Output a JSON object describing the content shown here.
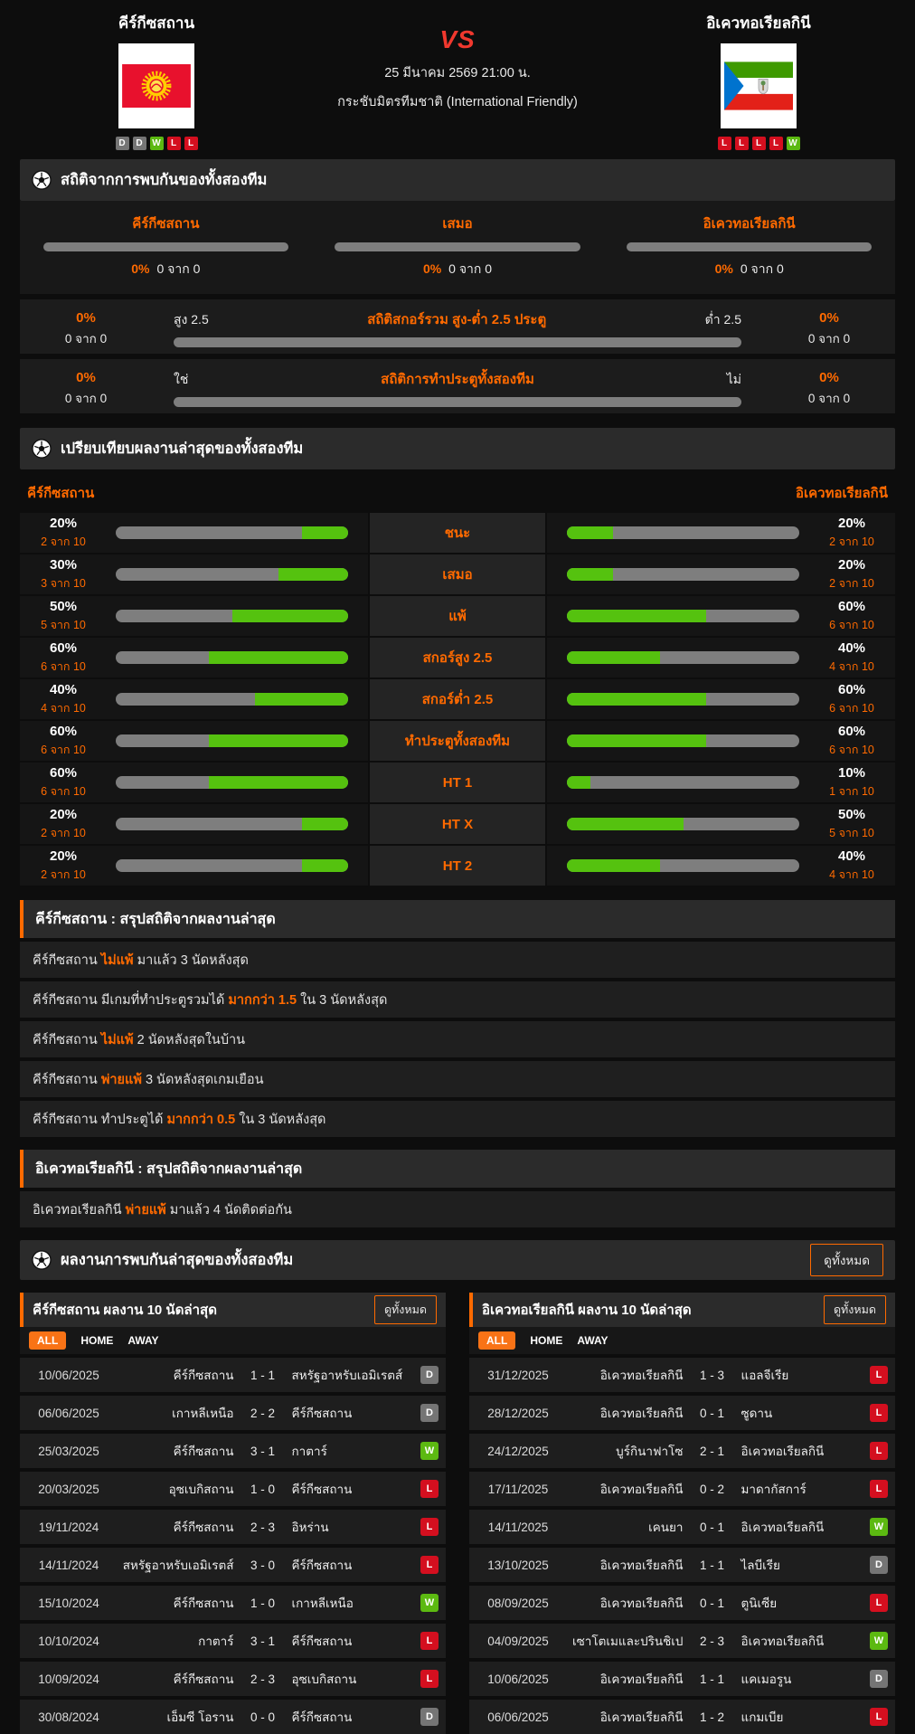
{
  "colors": {
    "accent_orange": "#ff6a00",
    "bar_green": "#55c20f",
    "bar_gray": "#7e7e7e",
    "badge_win": "#5cb911",
    "badge_draw": "#757575",
    "badge_loss": "#d40f1f",
    "vs_red": "#f0382e"
  },
  "header": {
    "home": {
      "name": "คีร์กีซสถาน",
      "form": [
        "D",
        "D",
        "W",
        "L",
        "L"
      ]
    },
    "away": {
      "name": "อิเควทอเรียลกินี",
      "form": [
        "L",
        "L",
        "L",
        "L",
        "W"
      ]
    },
    "vs": "VS",
    "datetime": "25 มีนาคม 2569 21:00 น.",
    "competition": "กระชับมิตรทีมชาติ (International Friendly)"
  },
  "h2h_stats": {
    "title": "สถิติจากการพบกันของทั้งสองทีม",
    "columns": [
      {
        "label": "คีร์กีซสถาน",
        "pct": "0%",
        "count": "0 จาก 0"
      },
      {
        "label": "เสมอ",
        "pct": "0%",
        "count": "0 จาก 0"
      },
      {
        "label": "อิเควทอเรียลกินี",
        "pct": "0%",
        "count": "0 จาก 0"
      }
    ],
    "bars": [
      {
        "left_pct": "0%",
        "left_count": "0 จาก 0",
        "label_left": "สูง 2.5",
        "title": "สถิติสกอร์รวม สูง-ต่ำ 2.5 ประตู",
        "label_right": "ต่ำ 2.5",
        "right_pct": "0%",
        "right_count": "0 จาก 0"
      },
      {
        "left_pct": "0%",
        "left_count": "0 จาก 0",
        "label_left": "ใช่",
        "title": "สถิติการทำประตูทั้งสองทีม",
        "label_right": "ไม่",
        "right_pct": "0%",
        "right_count": "0 จาก 0"
      }
    ]
  },
  "comparison": {
    "title": "เปรียบเทียบผลงานล่าสุดของทั้งสองทีม",
    "home_label": "คีร์กีซสถาน",
    "away_label": "อิเควทอเรียลกินี",
    "rows": [
      {
        "label": "ชนะ",
        "home_pct": 20,
        "home_pct_text": "20%",
        "home_count": "2 จาก 10",
        "away_pct": 20,
        "away_pct_text": "20%",
        "away_count": "2 จาก 10"
      },
      {
        "label": "เสมอ",
        "home_pct": 30,
        "home_pct_text": "30%",
        "home_count": "3 จาก 10",
        "away_pct": 20,
        "away_pct_text": "20%",
        "away_count": "2 จาก 10"
      },
      {
        "label": "แพ้",
        "home_pct": 50,
        "home_pct_text": "50%",
        "home_count": "5 จาก 10",
        "away_pct": 60,
        "away_pct_text": "60%",
        "away_count": "6 จาก 10"
      },
      {
        "label": "สกอร์สูง 2.5",
        "home_pct": 60,
        "home_pct_text": "60%",
        "home_count": "6 จาก 10",
        "away_pct": 40,
        "away_pct_text": "40%",
        "away_count": "4 จาก 10"
      },
      {
        "label": "สกอร์ต่ำ 2.5",
        "home_pct": 40,
        "home_pct_text": "40%",
        "home_count": "4 จาก 10",
        "away_pct": 60,
        "away_pct_text": "60%",
        "away_count": "6 จาก 10"
      },
      {
        "label": "ทำประตูทั้งสองทีม",
        "home_pct": 60,
        "home_pct_text": "60%",
        "home_count": "6 จาก 10",
        "away_pct": 60,
        "away_pct_text": "60%",
        "away_count": "6 จาก 10"
      },
      {
        "label": "HT 1",
        "home_pct": 60,
        "home_pct_text": "60%",
        "home_count": "6 จาก 10",
        "away_pct": 10,
        "away_pct_text": "10%",
        "away_count": "1 จาก 10"
      },
      {
        "label": "HT X",
        "home_pct": 20,
        "home_pct_text": "20%",
        "home_count": "2 จาก 10",
        "away_pct": 50,
        "away_pct_text": "50%",
        "away_count": "5 จาก 10"
      },
      {
        "label": "HT 2",
        "home_pct": 20,
        "home_pct_text": "20%",
        "home_count": "2 จาก 10",
        "away_pct": 40,
        "away_pct_text": "40%",
        "away_count": "4 จาก 10"
      }
    ]
  },
  "home_summary": {
    "title": "คีร์กีซสถาน : สรุปสถิติจากผลงานล่าสุด",
    "items": [
      {
        "pre": "คีร์กีซสถาน ",
        "highlight": "ไม่แพ้",
        "post": " มาแล้ว 3 นัดหลังสุด"
      },
      {
        "pre": "คีร์กีซสถาน มีเกมที่ทำประตูรวมได้ ",
        "highlight": "มากกว่า 1.5",
        "post": " ใน 3 นัดหลังสุด"
      },
      {
        "pre": "คีร์กีซสถาน ",
        "highlight": "ไม่แพ้",
        "post": " 2 นัดหลังสุดในบ้าน"
      },
      {
        "pre": "คีร์กีซสถาน ",
        "highlight": "พ่ายแพ้",
        "post": " 3 นัดหลังสุดเกมเยือน"
      },
      {
        "pre": "คีร์กีซสถาน ทำประตูได้ ",
        "highlight": "มากกว่า 0.5",
        "post": " ใน 3 นัดหลังสุด"
      }
    ]
  },
  "away_summary": {
    "title": "อิเควทอเรียลกินี : สรุปสถิติจากผลงานล่าสุด",
    "items": [
      {
        "pre": "อิเควทอเรียลกินี ",
        "highlight": "พ่ายแพ้",
        "post": " มาแล้ว 4 นัดติดต่อกัน"
      }
    ]
  },
  "h2h_recent": {
    "title": "ผลงานการพบกันล่าสุดของทั้งสองทีม",
    "view_all": "ดูทั้งหมด"
  },
  "panels": [
    {
      "title": "คีร์กีซสถาน ผลงาน 10 นัดล่าสุด",
      "view_all": "ดูทั้งหมด",
      "tabs": [
        "ALL",
        "HOME",
        "AWAY"
      ],
      "active_tab": "ALL",
      "rows": [
        {
          "date": "10/06/2025",
          "home": "คีร์กีซสถาน",
          "score": "1 - 1",
          "away": "สหรัฐอาหรับเอมิเรตส์",
          "result": "D"
        },
        {
          "date": "06/06/2025",
          "home": "เกาหลีเหนือ",
          "score": "2 - 2",
          "away": "คีร์กีซสถาน",
          "result": "D"
        },
        {
          "date": "25/03/2025",
          "home": "คีร์กีซสถาน",
          "score": "3 - 1",
          "away": "กาตาร์",
          "result": "W"
        },
        {
          "date": "20/03/2025",
          "home": "อุซเบกิสถาน",
          "score": "1 - 0",
          "away": "คีร์กีซสถาน",
          "result": "L"
        },
        {
          "date": "19/11/2024",
          "home": "คีร์กีซสถาน",
          "score": "2 - 3",
          "away": "อิหร่าน",
          "result": "L"
        },
        {
          "date": "14/11/2024",
          "home": "สหรัฐอาหรับเอมิเรตส์",
          "score": "3 - 0",
          "away": "คีร์กีซสถาน",
          "result": "L"
        },
        {
          "date": "15/10/2024",
          "home": "คีร์กีซสถาน",
          "score": "1 - 0",
          "away": "เกาหลีเหนือ",
          "result": "W"
        },
        {
          "date": "10/10/2024",
          "home": "กาตาร์",
          "score": "3 - 1",
          "away": "คีร์กีซสถาน",
          "result": "L"
        },
        {
          "date": "10/09/2024",
          "home": "คีร์กีซสถาน",
          "score": "2 - 3",
          "away": "อุซเบกิสถาน",
          "result": "L"
        },
        {
          "date": "30/08/2024",
          "home": "เอ็มซี โอราน",
          "score": "0 - 0",
          "away": "คีร์กีซสถาน",
          "result": "D"
        }
      ]
    },
    {
      "title": "อิเควทอเรียลกินี ผลงาน 10 นัดล่าสุด",
      "view_all": "ดูทั้งหมด",
      "tabs": [
        "ALL",
        "HOME",
        "AWAY"
      ],
      "active_tab": "ALL",
      "rows": [
        {
          "date": "31/12/2025",
          "home": "อิเควทอเรียลกินี",
          "score": "1 - 3",
          "away": "แอลจีเรีย",
          "result": "L"
        },
        {
          "date": "28/12/2025",
          "home": "อิเควทอเรียลกินี",
          "score": "0 - 1",
          "away": "ซูดาน",
          "result": "L"
        },
        {
          "date": "24/12/2025",
          "home": "บูร์กินาฟาโซ",
          "score": "2 - 1",
          "away": "อิเควทอเรียลกินี",
          "result": "L"
        },
        {
          "date": "17/11/2025",
          "home": "อิเควทอเรียลกินี",
          "score": "0 - 2",
          "away": "มาดากัสการ์",
          "result": "L"
        },
        {
          "date": "14/11/2025",
          "home": "เคนยา",
          "score": "0 - 1",
          "away": "อิเควทอเรียลกินี",
          "result": "W"
        },
        {
          "date": "13/10/2025",
          "home": "อิเควทอเรียลกินี",
          "score": "1 - 1",
          "away": "ไลบีเรีย",
          "result": "D"
        },
        {
          "date": "08/09/2025",
          "home": "อิเควทอเรียลกินี",
          "score": "0 - 1",
          "away": "ตูนิเซีย",
          "result": "L"
        },
        {
          "date": "04/09/2025",
          "home": "เซาโตเมและปรินชิเป",
          "score": "2 - 3",
          "away": "อิเควทอเรียลกินี",
          "result": "W"
        },
        {
          "date": "10/06/2025",
          "home": "อิเควทอเรียลกินี",
          "score": "1 - 1",
          "away": "แคเมอรูน",
          "result": "D"
        },
        {
          "date": "06/06/2025",
          "home": "อิเควทอเรียลกินี",
          "score": "1 - 2",
          "away": "แกมเบีย",
          "result": "L"
        }
      ]
    }
  ]
}
